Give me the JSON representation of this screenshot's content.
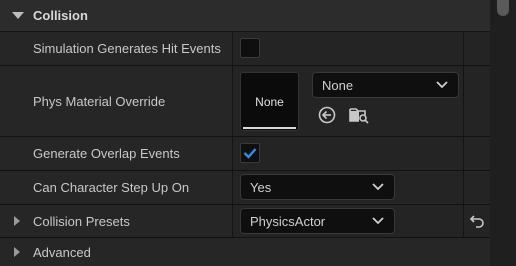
{
  "section": {
    "title": "Collision"
  },
  "rows": {
    "sim_hit": {
      "label": "Simulation Generates Hit Events",
      "checked": false
    },
    "phys_material": {
      "label": "Phys Material Override",
      "thumbnail_label": "None",
      "selected": "None",
      "icons": [
        "use-selected-arrow-icon",
        "browse-folder-search-icon"
      ]
    },
    "overlap": {
      "label": "Generate Overlap Events",
      "checked": true
    },
    "step_up": {
      "label": "Can Character Step Up On",
      "selected": "Yes"
    },
    "presets": {
      "label": "Collision Presets",
      "selected": "PhysicsActor",
      "reset_icon": "reset-to-default-icon"
    },
    "advanced": {
      "label": "Advanced"
    }
  },
  "colors": {
    "accent_check": "#2f8fe8",
    "background": "#1b1b1b",
    "row_background": "#262626",
    "input_background": "#0f0f0f"
  }
}
